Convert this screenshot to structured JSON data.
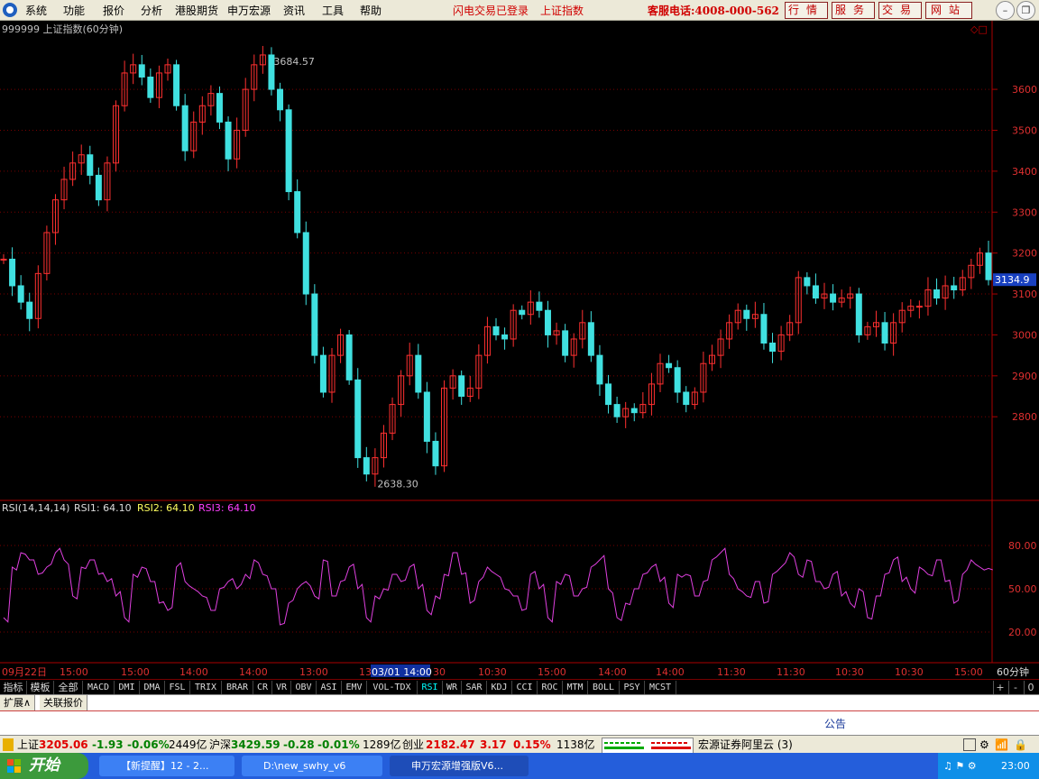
{
  "menu": {
    "items": [
      "系统",
      "功能",
      "报价",
      "分析",
      "港股期货",
      "申万宏源",
      "资讯",
      "工具",
      "帮助"
    ]
  },
  "status": {
    "flash_trade": "闪电交易已登录",
    "index_name": "上证指数"
  },
  "hotline": "客服电话:4008-000-562",
  "top_buttons": [
    "行情",
    "服务",
    "交易",
    "网站"
  ],
  "chart": {
    "title": "999999 上证指数(60分钟)",
    "high_label": "3684.57",
    "low_label": "2638.30",
    "price_label": "3134.9",
    "y_ticks": [
      "3600",
      "3500",
      "3400",
      "3300",
      "3200",
      "3100",
      "3000",
      "2900",
      "2800"
    ],
    "rsi_label": "RSI(14,14,14)",
    "rsi1": "RSI1: 64.10",
    "rsi2": "RSI2: 64.10",
    "rsi3": "RSI3: 64.10",
    "rsi_ticks": [
      "80.00",
      "50.00",
      "20.00"
    ],
    "x_ticks": [
      "09月22日",
      "15:00",
      "15:00",
      "14:00",
      "14:00",
      "13:00",
      "13",
      "03/01 14:00",
      "30",
      "10:30",
      "15:00",
      "14:00",
      "14:00",
      "11:30",
      "11:30",
      "10:30",
      "10:30",
      "15:00"
    ],
    "period": "60分钟"
  },
  "chart_data": {
    "type": "line",
    "title": "999999 上证指数(60分钟)",
    "xlabel": "",
    "ylabel": "",
    "ylim": [
      2600,
      3750
    ],
    "series": [
      {
        "name": "Close",
        "values": [
          3185,
          3120,
          3080,
          3040,
          3150,
          3250,
          3330,
          3380,
          3420,
          3440,
          3390,
          3330,
          3420,
          3560,
          3640,
          3660,
          3630,
          3580,
          3640,
          3660,
          3560,
          3450,
          3520,
          3560,
          3590,
          3520,
          3430,
          3500,
          3600,
          3660,
          3684,
          3600,
          3550,
          3350,
          3250,
          3100,
          2950,
          2860,
          2950,
          3000,
          2890,
          2700,
          2660,
          2700,
          2760,
          2830,
          2900,
          2950,
          2860,
          2740,
          2680,
          2870,
          2900,
          2850,
          2870,
          2950,
          3020,
          3000,
          2990,
          3060,
          3050,
          3080,
          3060,
          3000,
          3010,
          2950,
          2990,
          3030,
          2950,
          2880,
          2830,
          2800,
          2820,
          2810,
          2830,
          2880,
          2930,
          2920,
          2860,
          2830,
          2860,
          2930,
          2950,
          2990,
          3030,
          3060,
          3040,
          3050,
          2980,
          2960,
          3000,
          3030,
          3140,
          3120,
          3090,
          3100,
          3080,
          3090,
          3100,
          3000,
          3020,
          3030,
          2980,
          3030,
          3060,
          3070,
          3070,
          3110,
          3090,
          3120,
          3110,
          3140,
          3170,
          3200,
          3134.9
        ]
      },
      {
        "name": "RSI1",
        "values": [
          30,
          65,
          75,
          70,
          60,
          65,
          75,
          70,
          45,
          65,
          70,
          60,
          55,
          45,
          30,
          60,
          65,
          55,
          40,
          35,
          65,
          55,
          50,
          45,
          35,
          50,
          55,
          50,
          60,
          70,
          60,
          50,
          25,
          40,
          50,
          55,
          45,
          70,
          45,
          55,
          65,
          50,
          30,
          45,
          50,
          60,
          55,
          65,
          50,
          35,
          45,
          60,
          75,
          60,
          40,
          55,
          65,
          60,
          50,
          45,
          35,
          60,
          50,
          30,
          55,
          60,
          45,
          50,
          65,
          70,
          50,
          30,
          40,
          50,
          60,
          65,
          55,
          40,
          60,
          60,
          45,
          55,
          70,
          75,
          60,
          50,
          45,
          55,
          40,
          60,
          65,
          75,
          60,
          70,
          55,
          50,
          60,
          45,
          40,
          50,
          30,
          45,
          60,
          70,
          55,
          50,
          65,
          60,
          70,
          55,
          40,
          60,
          70,
          65,
          64.1
        ]
      }
    ],
    "rsi_ylim": [
      0,
      100
    ]
  },
  "tabs": {
    "first": [
      "指标",
      "模板",
      "全部"
    ],
    "indicators": [
      "MACD",
      "DMI",
      "DMA",
      "FSL",
      "TRIX",
      "BRAR",
      "CR",
      "VR",
      "OBV",
      "ASI",
      "EMV",
      "VOL-TDX",
      "RSI",
      "WR",
      "SAR",
      "KDJ",
      "CCI",
      "ROC",
      "MTM",
      "BOLL",
      "PSY",
      "MCST"
    ],
    "active": "RSI",
    "controls": [
      "+",
      "-",
      "0"
    ]
  },
  "panel": {
    "tabs": [
      "扩展∧",
      "关联报价"
    ],
    "notice": "公告"
  },
  "ticker": {
    "sh_name": "上证",
    "sh_value": "3205.06",
    "sh_change": "-1.93",
    "sh_pct": "-0.06%",
    "sh_amount": "2449亿",
    "hs_name": "沪深",
    "hs_value": "3429.59",
    "hs_change": "-0.28",
    "hs_pct": "-0.01%",
    "hs_amount": "1289亿",
    "cy_name": "创业",
    "cy_value": "2182.47",
    "cy_change": "3.17",
    "cy_pct": "0.15%",
    "cy_amount": "1138亿",
    "broker": "宏源证券阿里云 (3)"
  },
  "taskbar": {
    "start": "开始",
    "tasks": [
      "【新提醒】12 - 2...",
      "D:\\new_swhy_v6",
      "申万宏源增强版V6..."
    ],
    "clock": "23:00"
  }
}
